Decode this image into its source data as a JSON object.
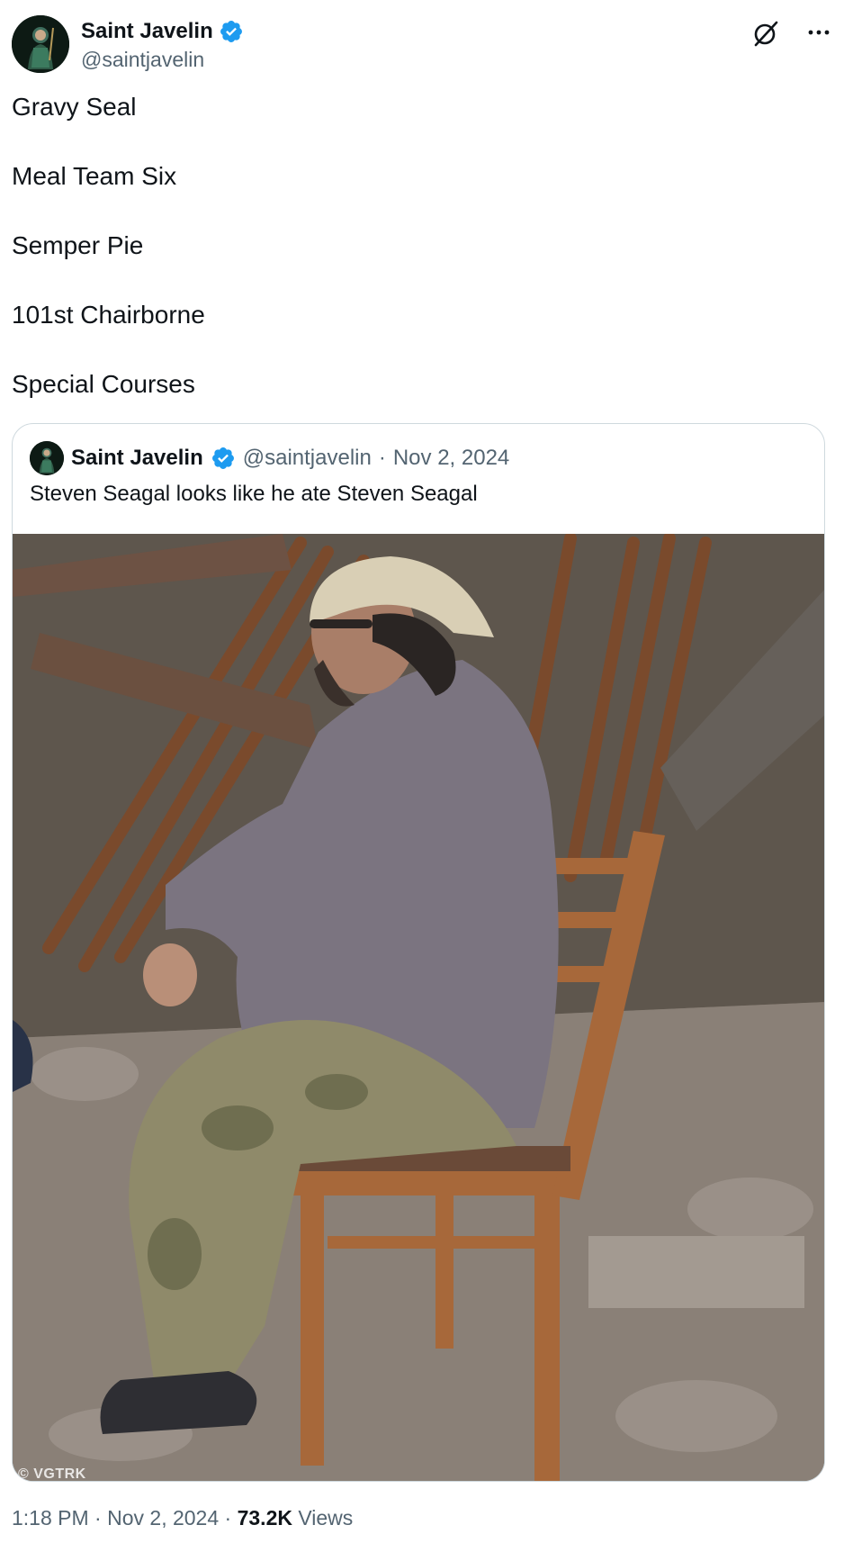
{
  "author": {
    "display_name": "Saint Javelin",
    "handle": "@saintjavelin"
  },
  "tweet": {
    "lines": [
      "Gravy Seal",
      "Meal Team Six",
      "Semper Pie",
      "101st Chairborne",
      "Special Courses"
    ]
  },
  "quote": {
    "display_name": "Saint Javelin",
    "handle": "@saintjavelin",
    "separator": "·",
    "date": "Nov 2, 2024",
    "text": "Steven Seagal looks like he ate Steven Seagal",
    "media_watermark": "© VGTRK"
  },
  "footer": {
    "time": "1:18 PM",
    "date": "Nov 2, 2024",
    "views_count": "73.2K",
    "views_label": "Views",
    "separator": "·"
  },
  "icons": {
    "verified": "verified-badge-icon",
    "grok": "grok-icon",
    "more": "more-icon"
  },
  "colors": {
    "verified_blue": "#1d9bf0",
    "text_primary": "#0f1419",
    "text_secondary": "#536471",
    "border": "#cfd9de"
  }
}
